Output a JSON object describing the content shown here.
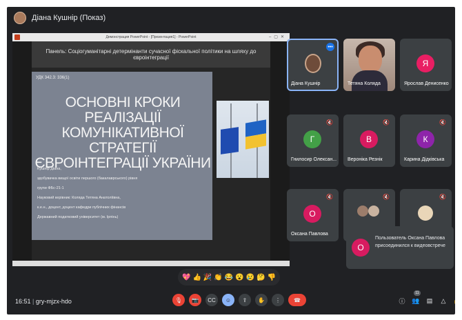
{
  "header": {
    "presenter": "Діана Кушнір (Показ)"
  },
  "presentation": {
    "window_title": "Демонстрация PowerPoint - [Презентация1] - PowerPoint",
    "panel": "Панель: Соціогуманітарні детермінанти сучасної фіскальної політики на шляху до євроінтеграції",
    "udk": "УДК 342.3: 336(1)",
    "heading": "ОСНОВНІ КРОКИ РЕАЛІЗАЦІЇ КОМУНІКАТИВНОЇ СТРАТЕГІЇ ЄВРОІНТЕГРАЦІЇ УКРАЇНИ",
    "meta_lines": [
      "Кушнір Діана,",
      "здобувачка вищої освіти першого (бакалаврського) рівня",
      "групи ФБс-21-1",
      "Науковий керівник: Коляда Тетяна Анатоліївна,",
      "к.е.н., доцент, доцент кафедри публічних фінансів",
      "Державний податковий університет (м. Ірпінь)"
    ]
  },
  "participants": [
    {
      "name": "Діана Кушнір",
      "kind": "photo",
      "selected": true
    },
    {
      "name": "Тетяна Коляда",
      "kind": "video"
    },
    {
      "name": "Ярослав Денисенко",
      "initial": "Я",
      "color": "#e91e63"
    },
    {
      "name": "Гнилосир Олексан...",
      "initial": "Г",
      "color": "#43a047"
    },
    {
      "name": "Вероніка Резнік",
      "initial": "В",
      "color": "#d81b60"
    },
    {
      "name": "Карина Дідківська",
      "initial": "К",
      "color": "#8e24aa"
    },
    {
      "name": "Оксана Павлова",
      "initial": "О",
      "color": "#d81b60"
    }
  ],
  "toast": {
    "initial": "О",
    "text": "Пользователь Оксана Павлова присоединился к видеовстрече"
  },
  "reactions": [
    "💖",
    "👍",
    "🎉",
    "👏",
    "😂",
    "😮",
    "😢",
    "🤔",
    "👎"
  ],
  "bottom": {
    "time": "16:51",
    "code": "gry-mjzx-hdo",
    "participant_count": "11"
  },
  "colors": {
    "accent": "#8ab4f8",
    "danger": "#ea4335",
    "background": "#202124"
  }
}
